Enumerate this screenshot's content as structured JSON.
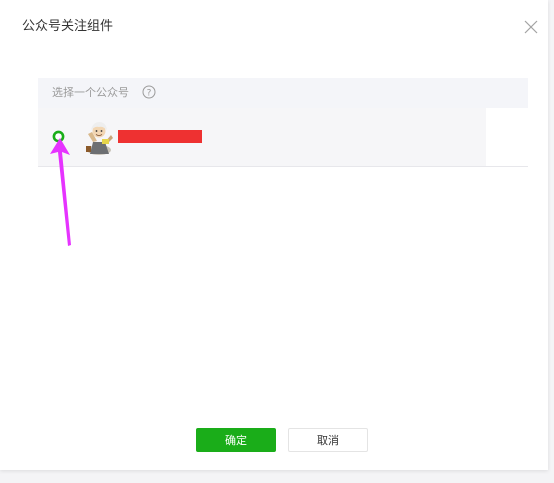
{
  "dialog": {
    "title": "公众号关注组件",
    "close_icon": "close-icon"
  },
  "table": {
    "header_label": "选择一个公众号",
    "help_icon": "question-circle-icon",
    "rows": [
      {
        "selected": true,
        "avatar_icon": "avatar-image",
        "name_redacted": true
      }
    ]
  },
  "footer": {
    "confirm_label": "确定",
    "cancel_label": "取消"
  },
  "colors": {
    "accent": "#1aad19",
    "redaction": "#ee3131",
    "annotation_arrow": "#e633ff",
    "header_bg": "#f4f5f9"
  }
}
